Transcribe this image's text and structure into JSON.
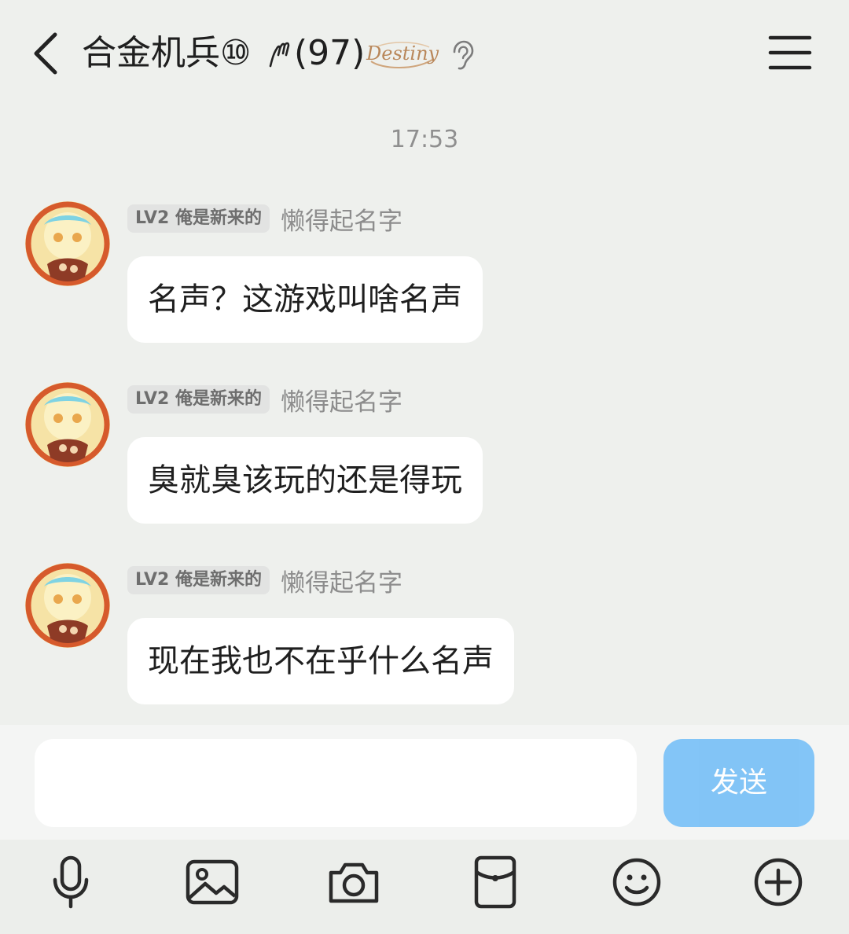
{
  "header": {
    "title": "合金机兵⑩",
    "member_count": "(97)",
    "badge_text": "Destiny",
    "icons": [
      "back-arrow-icon",
      "hand-icon",
      "destiny-badge",
      "ear-icon",
      "menu-icon"
    ]
  },
  "timestamp": "17:53",
  "messages": [
    {
      "level": "LV2 俺是新来的",
      "sender": "懒得起名字",
      "text": "名声？这游戏叫啥名声"
    },
    {
      "level": "LV2 俺是新来的",
      "sender": "懒得起名字",
      "text": "臭就臭该玩的还是得玩"
    },
    {
      "level": "LV2 俺是新来的",
      "sender": "懒得起名字",
      "text": "现在我也不在乎什么名声"
    }
  ],
  "input": {
    "value": "",
    "send_label": "发送"
  },
  "toolbar": [
    "microphone-icon",
    "image-icon",
    "camera-icon",
    "red-packet-icon",
    "emoji-icon",
    "plus-icon"
  ],
  "colors": {
    "background": "#eef0ed",
    "bubble": "#ffffff",
    "send_button": "#7cc2f7",
    "badge_bg": "#e2e3e2",
    "destiny_gold": "#b9875a"
  }
}
